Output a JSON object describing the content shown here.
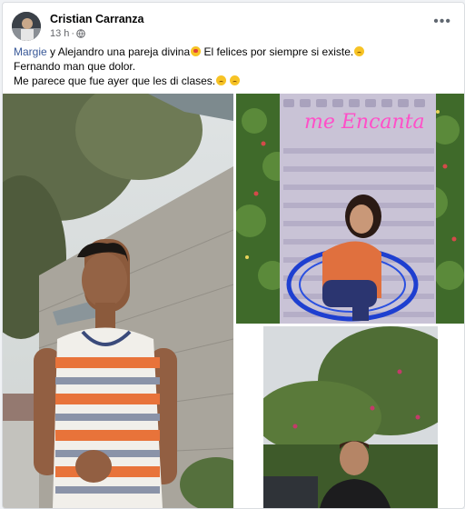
{
  "post": {
    "author": "Cristian Carranza",
    "time": "13 h",
    "separator": "·",
    "more_label": "•••",
    "caption": {
      "line1_mention": "Margie",
      "line1_text": " y Alejandro una pareja divina",
      "line1_text2": " El felices por siempre si existe.",
      "line2": "Fernando man que dolor.",
      "line3": "Me parece que fue ayer que les di clases."
    },
    "photos": [
      {
        "id": "photo-young-man-striped-tank"
      },
      {
        "id": "photo-woman-blue-chair",
        "neon_sign": "me Encanta"
      },
      {
        "id": "photo-man-with-greenery"
      }
    ]
  },
  "colors": {
    "link": "#385898",
    "neon": "#ff4fc8",
    "chair": "#1e3fd0"
  }
}
